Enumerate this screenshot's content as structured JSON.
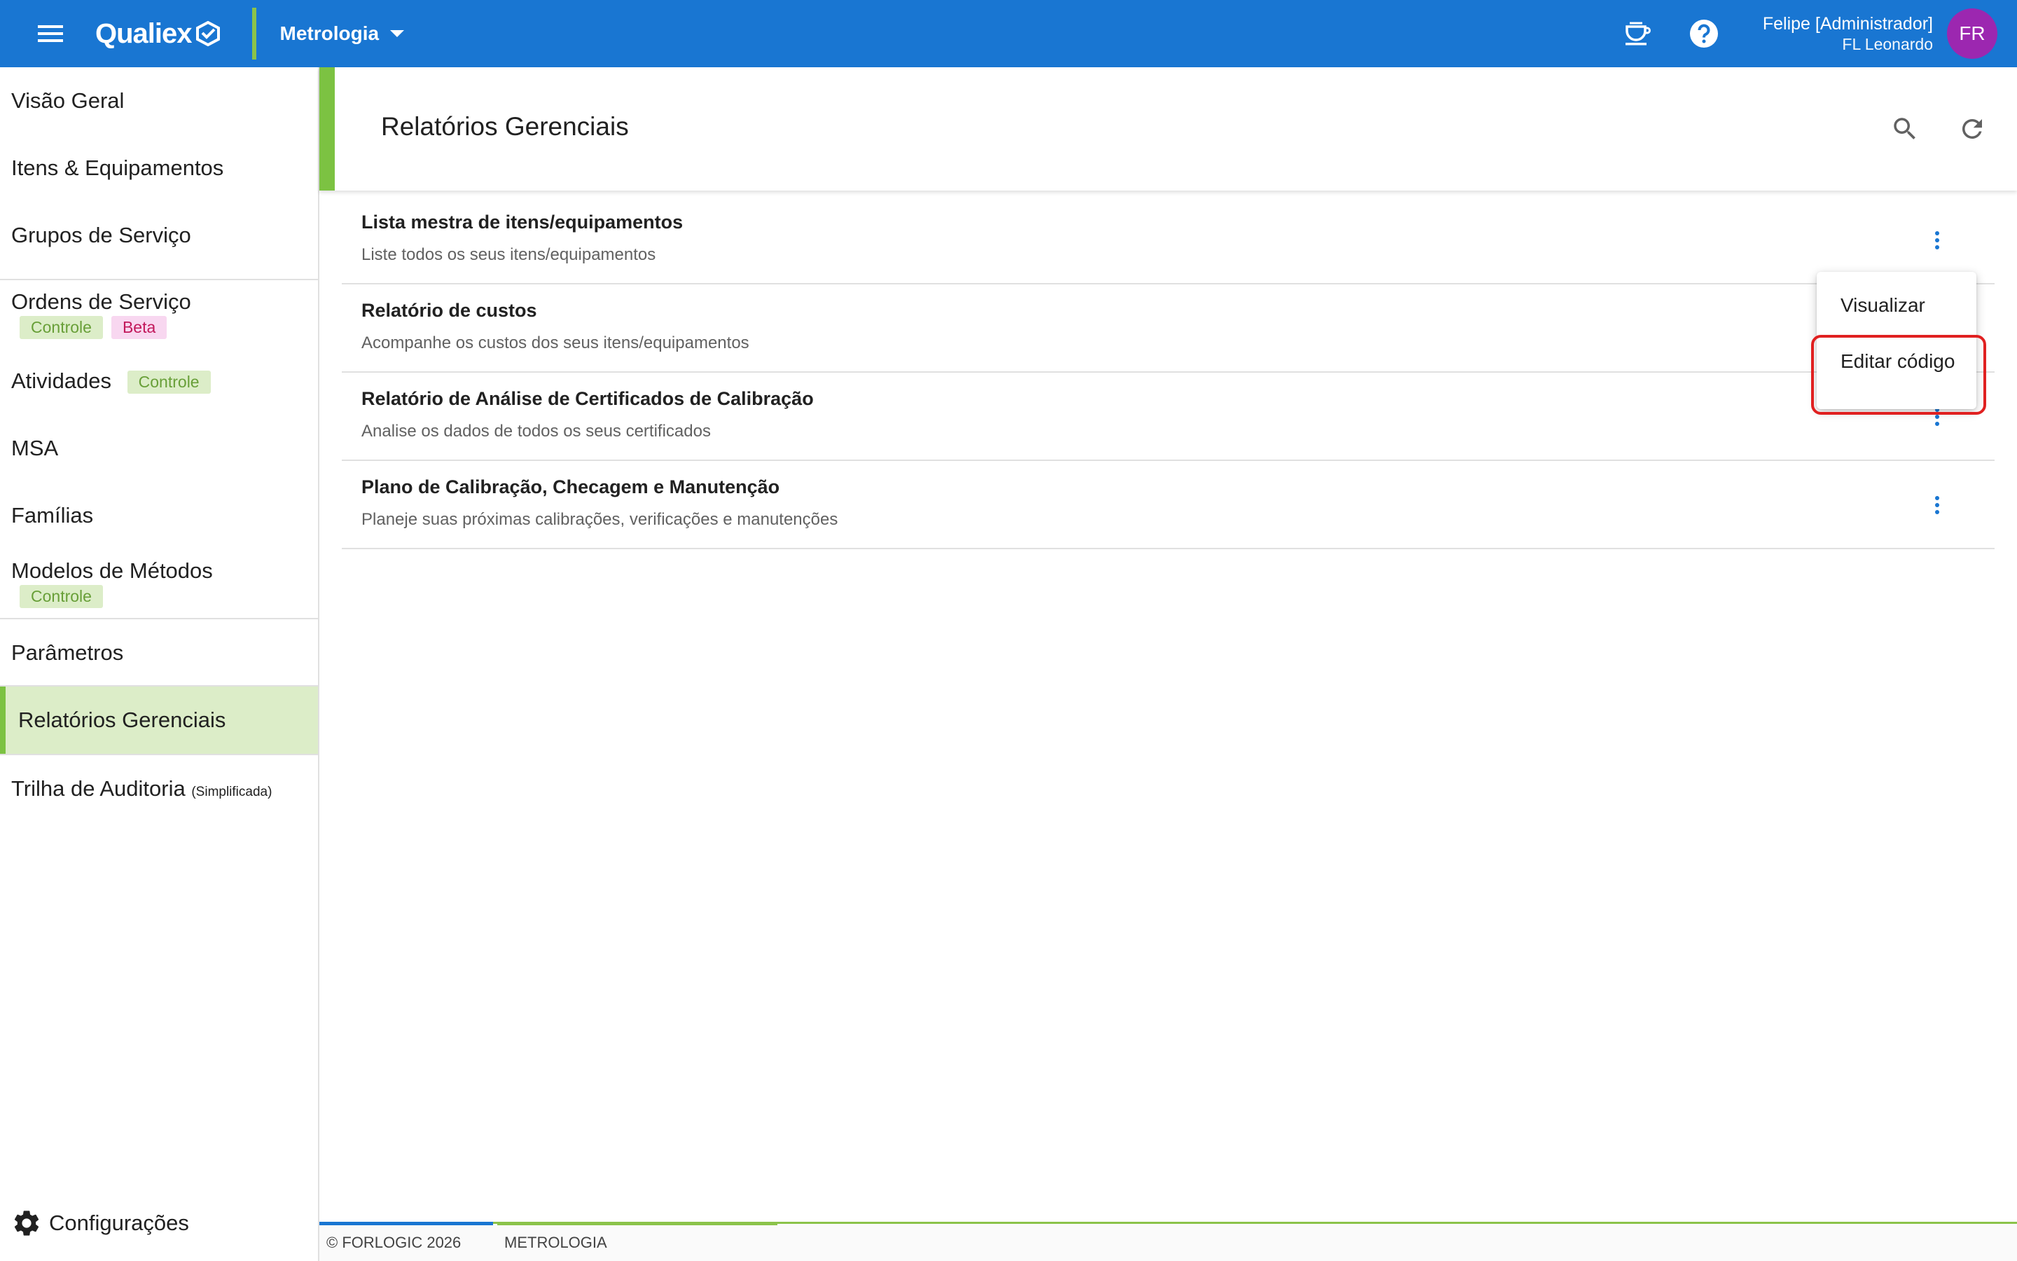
{
  "topbar": {
    "brand": "Qualiex",
    "module": "Metrologia",
    "user_name": "Felipe [Administrador]",
    "user_sub": "FL Leonardo",
    "avatar_initials": "FR",
    "colors": {
      "primary": "#1976d2",
      "accent": "#8bc34a",
      "avatar": "#9c27b0"
    }
  },
  "sidebar": {
    "items": [
      {
        "label": "Visão Geral"
      },
      {
        "label": "Itens & Equipamentos"
      },
      {
        "label": "Grupos de Serviço"
      },
      {
        "label": "Ordens de Serviço",
        "chips": [
          "Controle",
          "Beta"
        ]
      },
      {
        "label": "Atividades",
        "chips": [
          "Controle"
        ]
      },
      {
        "label": "MSA"
      },
      {
        "label": "Famílias"
      },
      {
        "label": "Modelos de Métodos",
        "chips": [
          "Controle"
        ]
      },
      {
        "label": "Parâmetros"
      },
      {
        "label": "Relatórios Gerenciais"
      },
      {
        "label": "Trilha de Auditoria",
        "suffix": "(Simplificada)"
      }
    ],
    "settings_label": "Configurações"
  },
  "main": {
    "title": "Relatórios Gerenciais",
    "reports": [
      {
        "title": "Lista mestra de itens/equipamentos",
        "description": "Liste todos os seus itens/equipamentos"
      },
      {
        "title": "Relatório de custos",
        "description": "Acompanhe os custos dos seus itens/equipamentos"
      },
      {
        "title": "Relatório de Análise de Certificados de Calibração",
        "description": "Analise os dados de todos os seus certificados"
      },
      {
        "title": "Plano de Calibração, Checagem e Manutenção",
        "description": "Planeje suas próximas calibrações, verificações e manutenções"
      }
    ]
  },
  "context_menu": {
    "items": [
      "Visualizar",
      "Editar código"
    ]
  },
  "footer": {
    "copyright": "© FORLOGIC 2026",
    "module": "METROLOGIA"
  }
}
